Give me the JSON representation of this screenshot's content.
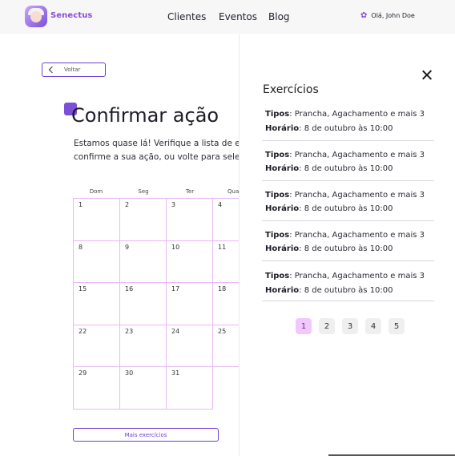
{
  "header": {
    "brand": "Senectus",
    "nav": [
      "Clientes",
      "Eventos",
      "Blog"
    ],
    "user_greeting": "Olá, John Doe"
  },
  "main": {
    "back_label": "Voltar",
    "title": "Confirmar ação",
    "description_line1": "Estamos quase lá! Verifique a lista de exe",
    "description_line2": "confirme a sua ação, ou volte para seleci",
    "calendar": {
      "weekdays": [
        "Dom",
        "Seg",
        "Ter",
        "Qua"
      ],
      "days": [
        "1",
        "2",
        "3",
        "4",
        "8",
        "9",
        "10",
        "11",
        "15",
        "16",
        "17",
        "18",
        "22",
        "23",
        "24",
        "25",
        "29",
        "30",
        "31"
      ]
    },
    "more_label": "Mais exercícios"
  },
  "drawer": {
    "title": "Exercícios",
    "items": [
      {
        "types_label": "Tipos",
        "types_value": ": Prancha, Agachamento e mais 3",
        "time_label": "Horário",
        "time_value": ": 8 de outubro às 10:00"
      },
      {
        "types_label": "Tipos",
        "types_value": ": Prancha, Agachamento e mais 3",
        "time_label": "Horário",
        "time_value": ": 8 de outubro às 10:00"
      },
      {
        "types_label": "Tipos",
        "types_value": ": Prancha, Agachamento e mais 3",
        "time_label": "Horário",
        "time_value": ": 8 de outubro às 10:00"
      },
      {
        "types_label": "Tipos",
        "types_value": ": Prancha, Agachamento e mais 3",
        "time_label": "Horário",
        "time_value": ": 8 de outubro às 10:00"
      },
      {
        "types_label": "Tipos",
        "types_value": ": Prancha, Agachamento e mais 3",
        "time_label": "Horário",
        "time_value": ": 8 de outubro às 10:00"
      }
    ],
    "pages": [
      "1",
      "2",
      "3",
      "4",
      "5"
    ],
    "active_page": "1"
  },
  "colors": {
    "accent": "#7b4fd6",
    "calendar_border": "#e8b9f2",
    "active_page_bg": "#f3c6ff"
  },
  "icons": [
    "logo-avatar-icon",
    "gear-icon",
    "chevron-left-icon",
    "close-icon"
  ]
}
